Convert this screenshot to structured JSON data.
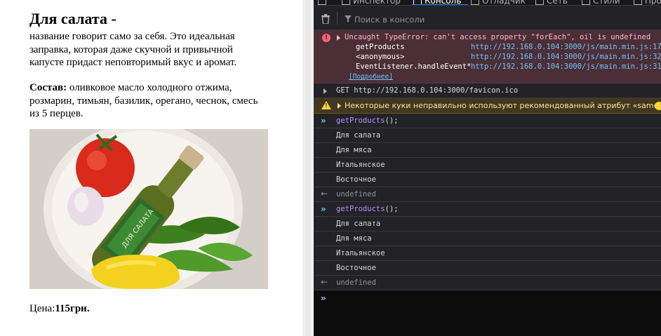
{
  "product": {
    "title": "Для салата -",
    "description": "название говорит само за себя. Это идеальная заправка, которая даже скучной и привычной капусте придаст неповторимый вкус и аромат.",
    "composition_label": "Состав:",
    "composition_text": " оливковое масло холодного отжима, розмарин, тимьян, базилик, орегано, чеснок, смесь из 5 перцев.",
    "price_label": "Цена:",
    "price_value": "115грн."
  },
  "devtools": {
    "tabs": [
      {
        "label": "Инспектор",
        "icon": "inspector-icon"
      },
      {
        "label": "Консоль",
        "icon": "console-icon"
      },
      {
        "label": "Отладчик",
        "icon": "debugger-icon"
      },
      {
        "label": "Сеть",
        "icon": "network-icon"
      },
      {
        "label": "Стили",
        "icon": "styles-icon"
      },
      {
        "label": "Про",
        "icon": "profiler-icon"
      }
    ],
    "active_tab": "Консоль",
    "search_placeholder": "Поиск в консоли",
    "error": {
      "message": "Uncaught TypeError: can't access property \"forEach\", oil is undefined",
      "stack": [
        {
          "fn": "getProducts",
          "link": "http://192.168.0.104:3000/js/main.min.js:17"
        },
        {
          "fn": "<anonymous>",
          "link": "http://192.168.0.104:3000/js/main.min.js:32"
        },
        {
          "fn": "EventListener.handleEvent*",
          "link": "http://192.168.0.104:3000/js/main.min.js:31"
        }
      ],
      "more": "[Подробнее]"
    },
    "network": "GET http://192.168.0.104:3000/favicon.ico",
    "warning": "Некоторые куки неправильно используют рекомендованный атрибут «sameSite»",
    "entries": [
      {
        "input_fn": "getProducts",
        "input_rest": "();",
        "outputs": [
          "Для салата",
          "Для мяса",
          "Итальянское",
          "Восточное"
        ],
        "result": "undefined"
      },
      {
        "input_fn": "getProducts",
        "input_rest": "();",
        "outputs": [
          "Для салата",
          "Для мяса",
          "Итальянское",
          "Восточное"
        ],
        "result": "undefined"
      }
    ],
    "colors": {
      "background": "#232327",
      "error_bg": "#4b2f36",
      "warning_bg": "#42381f",
      "link": "#75bfff",
      "function": "#b98eff"
    }
  }
}
